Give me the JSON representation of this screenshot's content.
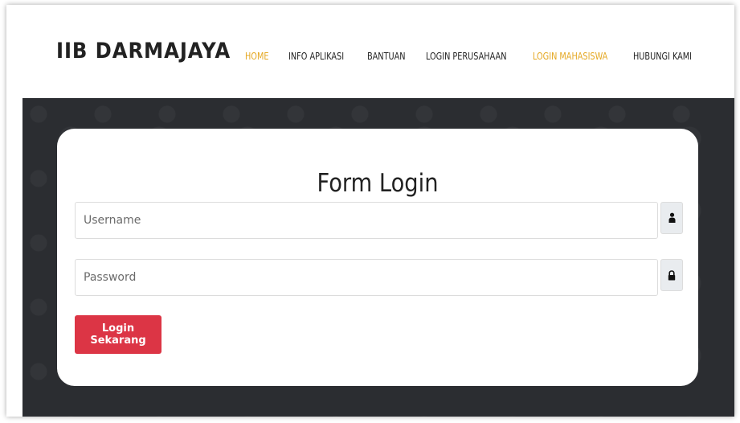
{
  "brand": "IIB DARMAJAYA",
  "nav": {
    "items": [
      {
        "label": "HOME",
        "active": true
      },
      {
        "label": "INFO APLIKASI",
        "active": false
      },
      {
        "label": "BANTUAN",
        "active": false
      },
      {
        "label": "LOGIN PERUSAHAAN",
        "active": false
      },
      {
        "label": "LOGIN MAHASISWA",
        "active": true
      },
      {
        "label": "HUBUNGI KAMI",
        "active": false
      }
    ]
  },
  "form": {
    "title": "Form Login",
    "username_placeholder": "Username",
    "username_icon": "user-icon",
    "password_placeholder": "Password",
    "password_icon": "lock-icon",
    "submit_label": "Login Sekarang"
  },
  "colors": {
    "accent": "#e5a823",
    "button": "#dc3545",
    "hero_bg": "#2b2d31"
  }
}
